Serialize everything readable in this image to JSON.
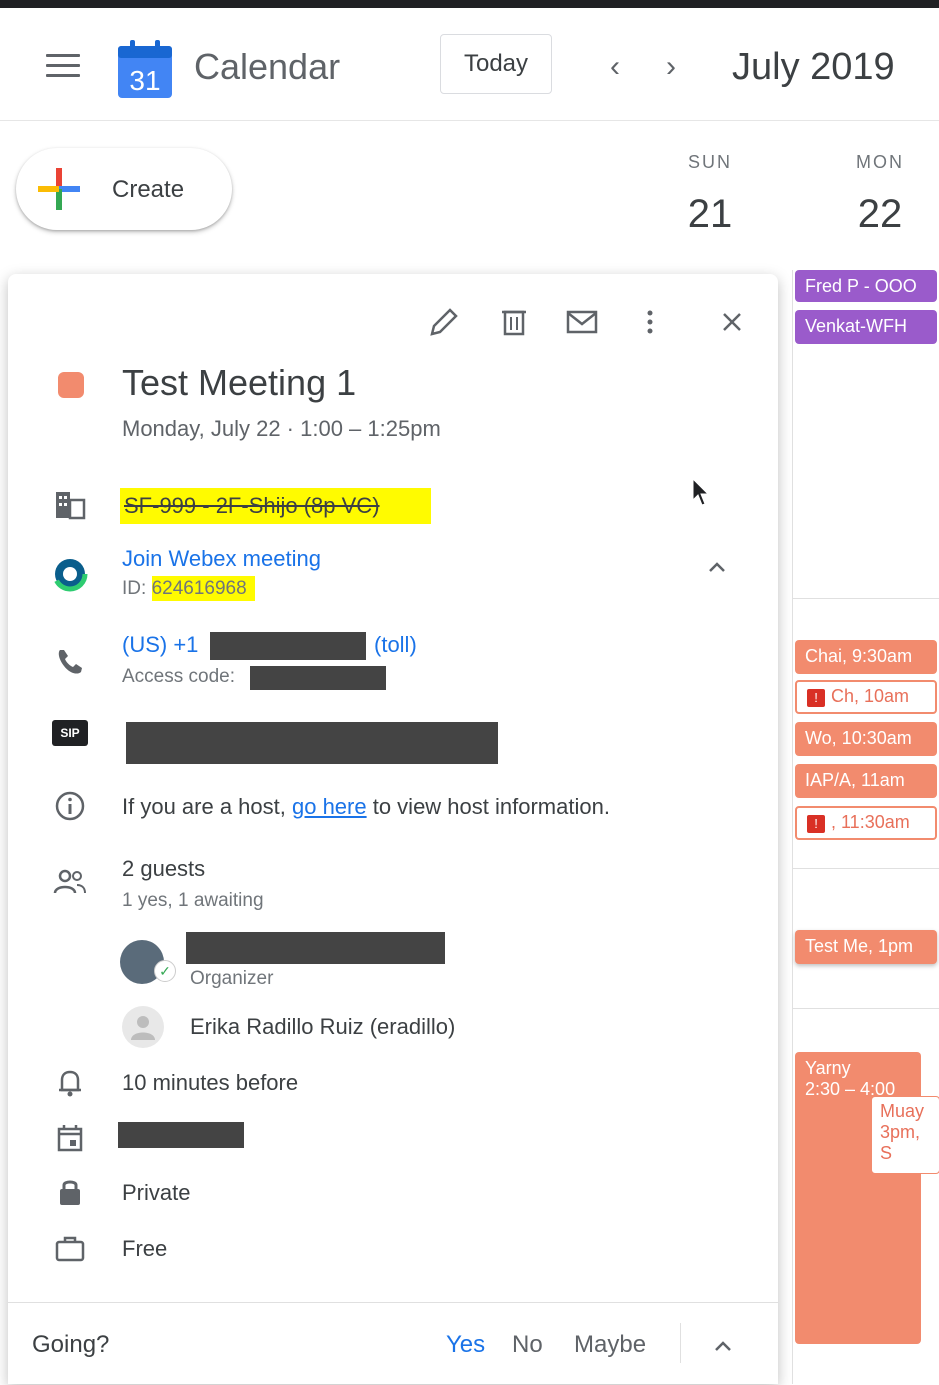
{
  "header": {
    "app_title": "Calendar",
    "logo_day": "31",
    "today_label": "Today",
    "prev_icon": "chevron-left-icon",
    "next_icon": "chevron-right-icon",
    "month_label": "July 2019"
  },
  "create": {
    "label": "Create"
  },
  "days": [
    {
      "dow": "SUN",
      "num": "21"
    },
    {
      "dow": "MON",
      "num": "22"
    }
  ],
  "calendar_events": [
    {
      "label": "Fred P - OOO",
      "color": "#9a5bcb"
    },
    {
      "label": "Venkat-WFH",
      "color": "#9a5bcb"
    },
    {
      "label": "Chai, 9:30am",
      "color": "#f28b6e"
    },
    {
      "label": "Ch, 10am",
      "color": "#f28b6e"
    },
    {
      "label": "Wo, 10:30am",
      "color": "#f28b6e"
    },
    {
      "label": "IAP/A, 11am",
      "color": "#f28b6e"
    },
    {
      "label": ", 11:30am",
      "color": "#f28b6e"
    },
    {
      "label": "Test Me, 1pm",
      "color": "#f28b6e"
    },
    {
      "label": "Yarny",
      "time": "2:30 – 4:00",
      "color": "#f28b6e"
    },
    {
      "label": "Muay",
      "time": "3pm, S",
      "color": "#f28b6e"
    }
  ],
  "event": {
    "title": "Test Meeting 1",
    "datetime": "Monday, July 22  ·  1:00 – 1:25pm",
    "color": "#f28b6e",
    "room": "SF-999 - 2F-Shijo (8p VC)",
    "webex_link": "Join Webex meeting",
    "webex_id_label": "ID: ",
    "webex_id": "624616968",
    "phone_prefix": "(US) +1",
    "phone_suffix": "(toll)",
    "access_code_label": "Access code:",
    "sip_label": "SIP",
    "host_text_before": "If you are a host, ",
    "host_link": "go here",
    "host_text_after": " to view host information.",
    "guests_title": "2 guests",
    "guests_sub": "1 yes, 1 awaiting",
    "organizer_label": "Organizer",
    "guest2_name": "Erika Radillo Ruiz (eradillo)",
    "reminder": "10 minutes before",
    "visibility": "Private",
    "availability": "Free"
  },
  "footer": {
    "going_label": "Going?",
    "yes": "Yes",
    "no": "No",
    "maybe": "Maybe"
  },
  "colors": {
    "accent": "#1a73e8",
    "event": "#f28b6e",
    "purple": "#9a5bcb",
    "highlight": "#fffb00"
  }
}
